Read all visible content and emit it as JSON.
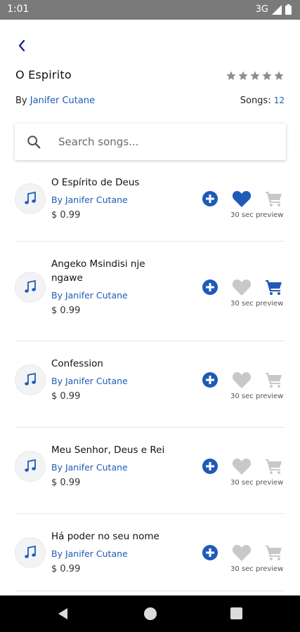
{
  "status_bar": {
    "time": "1:01",
    "network": "3G"
  },
  "album": {
    "title": "O Espirito",
    "by_prefix": "By ",
    "artist": "Janifer Cutane",
    "songs_label": "Songs: ",
    "songs_count": "12",
    "rating": 0,
    "rating_max": 5
  },
  "search": {
    "placeholder": "Search songs..."
  },
  "songs": [
    {
      "title": "O Espírito de Deus",
      "artist": "By Janifer Cutane",
      "price": "$ 0.99",
      "preview": "30 sec preview",
      "liked": true,
      "in_cart": false
    },
    {
      "title": "Angeko Msindisi nje ngawe",
      "artist": "By Janifer Cutane",
      "price": "$ 0.99",
      "preview": "30 sec preview",
      "liked": false,
      "in_cart": true
    },
    {
      "title": "Confession",
      "artist": "By Janifer Cutane",
      "price": "$ 0.99",
      "preview": "30 sec preview",
      "liked": false,
      "in_cart": false
    },
    {
      "title": "Meu Senhor, Deus e Rei",
      "artist": "By Janifer Cutane",
      "price": "$ 0.99",
      "preview": "30 sec preview",
      "liked": false,
      "in_cart": false
    },
    {
      "title": "Há poder no seu nome",
      "artist": "By Janifer Cutane",
      "price": "$ 0.99",
      "preview": "30 sec preview",
      "liked": false,
      "in_cart": false
    }
  ],
  "colors": {
    "accent": "#1e5bb8",
    "inactive": "#c8c8c8",
    "star": "#8e8e8e"
  },
  "icons": {
    "back": "chevron-left-icon",
    "rating": "star-icon",
    "search": "search-icon",
    "song": "music-note-icon",
    "add": "plus-circle-icon",
    "like": "heart-icon",
    "cart": "cart-icon"
  }
}
